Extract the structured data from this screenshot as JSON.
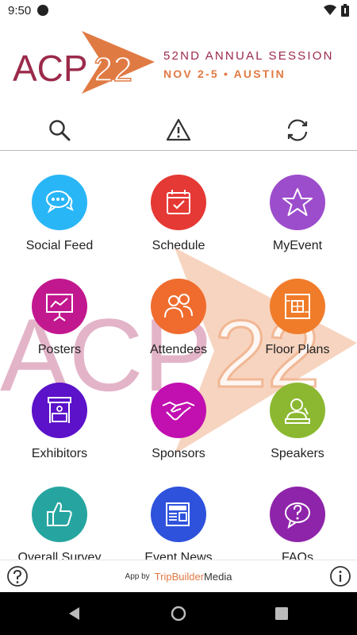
{
  "status": {
    "time": "9:50"
  },
  "banner": {
    "logo_text": "ACP",
    "logo_number": "22",
    "line1": "52ND ANNUAL SESSION",
    "line2": "NOV 2-5 • AUSTIN"
  },
  "toolbar": {
    "items": [
      "search-icon",
      "alert-icon",
      "sync-icon"
    ]
  },
  "tiles": [
    {
      "label": "Social Feed",
      "icon": "chat-bubbles-icon",
      "color": "#29b6f6"
    },
    {
      "label": "Schedule",
      "icon": "calendar-icon",
      "color": "#e53935"
    },
    {
      "label": "MyEvent",
      "icon": "star-icon",
      "color": "#9c4dcc"
    },
    {
      "label": "Posters",
      "icon": "presentation-icon",
      "color": "#c2188f"
    },
    {
      "label": "Attendees",
      "icon": "people-icon",
      "color": "#ef6c2e"
    },
    {
      "label": "Floor Plans",
      "icon": "floor-plan-icon",
      "color": "#f07c2a"
    },
    {
      "label": "Exhibitors",
      "icon": "booth-icon",
      "color": "#5b12c9"
    },
    {
      "label": "Sponsors",
      "icon": "handshake-icon",
      "color": "#c10fb0"
    },
    {
      "label": "Speakers",
      "icon": "speaker-icon",
      "color": "#8bb830"
    },
    {
      "label": "Overall Survey",
      "icon": "thumbs-up-icon",
      "color": "#26a5a0"
    },
    {
      "label": "Event News",
      "icon": "newspaper-icon",
      "color": "#2f52dc"
    },
    {
      "label": "FAQs",
      "icon": "question-bubble-icon",
      "color": "#8e24aa"
    }
  ],
  "footer": {
    "app_by": "App by",
    "brand_part1": "TripBuilder",
    "brand_part2": "Media"
  },
  "colors": {
    "brand_maroon": "#9b2a4a",
    "brand_orange": "#e07a43",
    "divider": "#bbbbbb"
  }
}
